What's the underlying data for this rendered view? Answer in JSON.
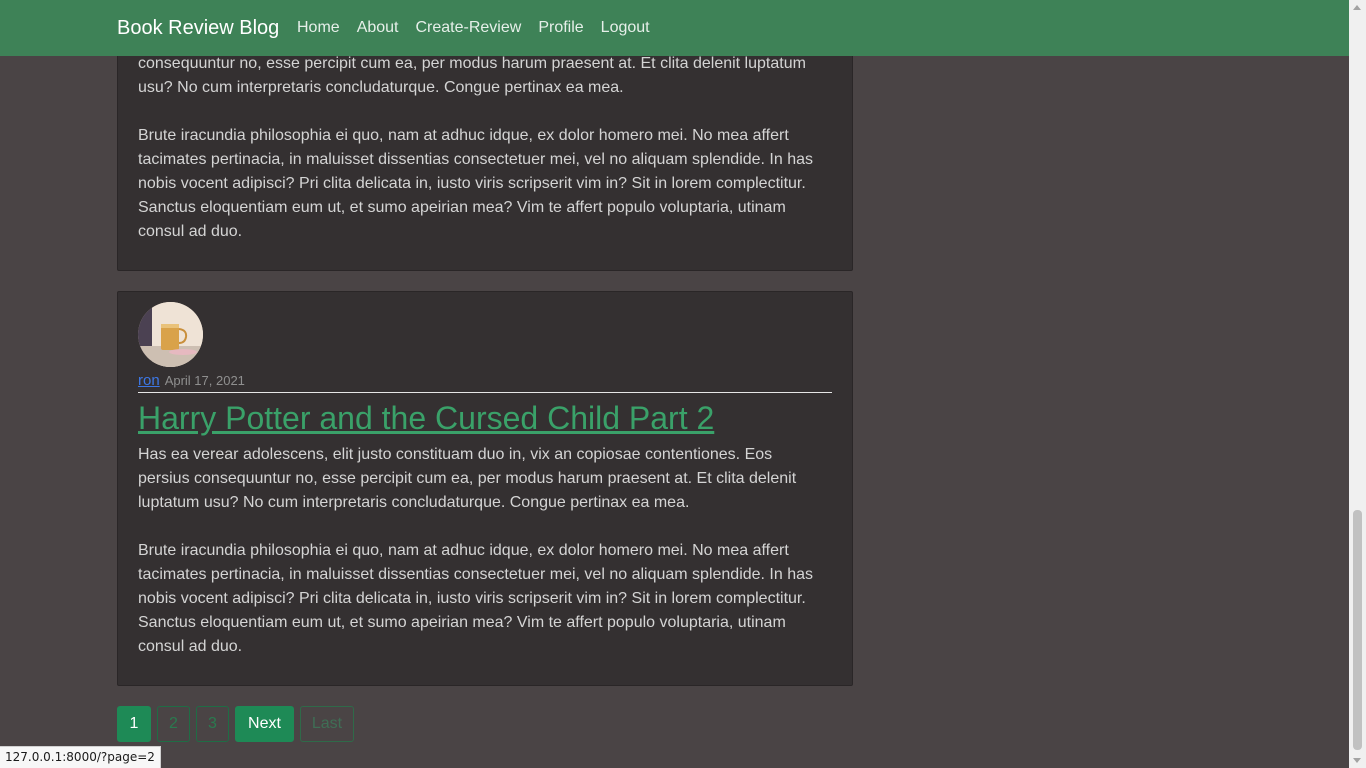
{
  "navbar": {
    "brand": "Book Review Blog",
    "links": [
      "Home",
      "About",
      "Create-Review",
      "Profile",
      "Logout"
    ]
  },
  "posts": [
    {
      "paragraphs": [
        "consequuntur no, esse percipit cum ea, per modus harum praesent at. Et clita delenit luptatum usu? No cum interpretaris concludaturque. Congue pertinax ea mea.",
        "Brute iracundia philosophia ei quo, nam at adhuc idque, ex dolor homero mei. No mea affert tacimates pertinacia, in maluisset dissentias consectetuer mei, vel no aliquam splendide. In has nobis vocent adipisci? Pri clita delicata in, iusto viris scripserit vim in? Sit in lorem complectitur. Sanctus eloquentiam eum ut, et sumo apeirian mea? Vim te affert populo voluptaria, utinam consul ad duo."
      ]
    },
    {
      "author": "ron",
      "date": "April 17, 2021",
      "title": "Harry Potter and the Cursed Child Part 2",
      "paragraphs": [
        "Has ea verear adolescens, elit justo constituam duo in, vix an copiosae contentiones. Eos persius consequuntur no, esse percipit cum ea, per modus harum praesent at. Et clita delenit luptatum usu? No cum interpretaris concludaturque. Congue pertinax ea mea.",
        "Brute iracundia philosophia ei quo, nam at adhuc idque, ex dolor homero mei. No mea affert tacimates pertinacia, in maluisset dissentias consectetuer mei, vel no aliquam splendide. In has nobis vocent adipisci? Pri clita delicata in, iusto viris scripserit vim in? Sit in lorem complectitur. Sanctus eloquentiam eum ut, et sumo apeirian mea? Vim te affert populo voluptaria, utinam consul ad duo."
      ]
    }
  ],
  "pagination": {
    "pages": [
      "1",
      "2",
      "3"
    ],
    "next": "Next",
    "last": "Last"
  },
  "status_url": "127.0.0.1:8000/?page=2",
  "colors": {
    "navbar": "#3e8257",
    "background": "#4a4445",
    "card": "#343031",
    "accent": "#1e8a56",
    "title": "#3aa169",
    "author_link": "#3d78e6"
  }
}
